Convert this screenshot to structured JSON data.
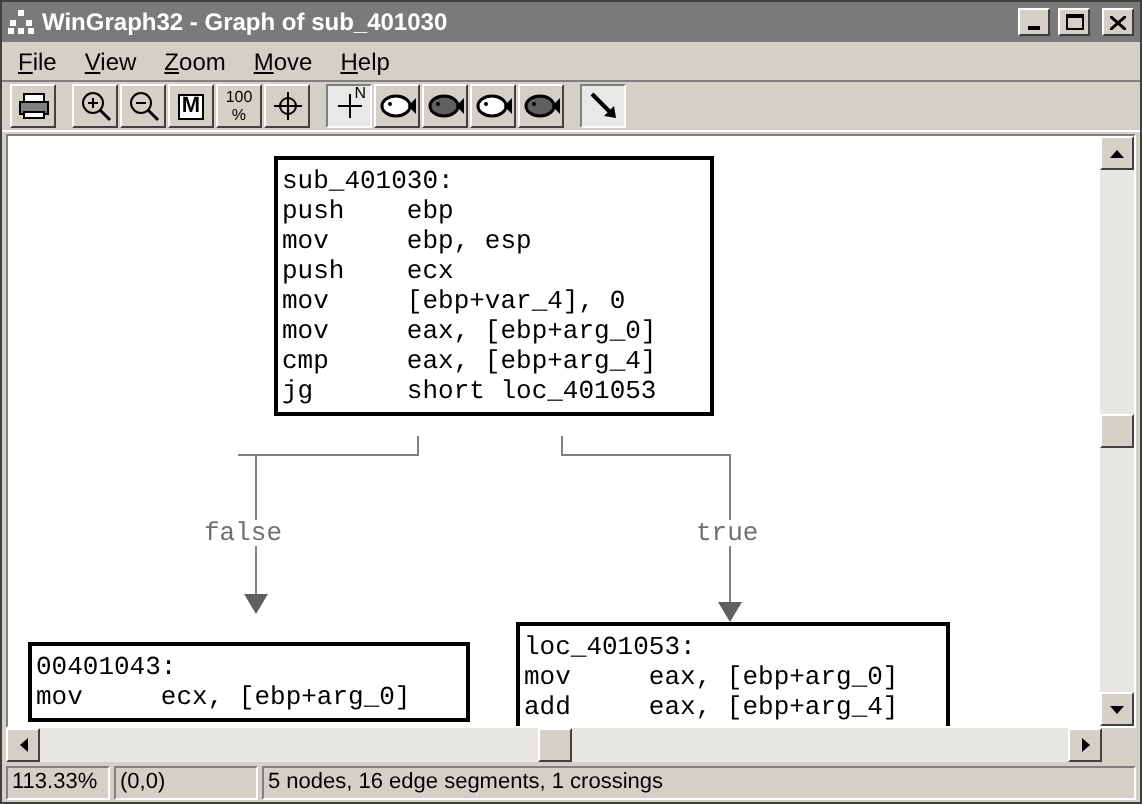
{
  "window": {
    "title": "WinGraph32 - Graph of sub_401030"
  },
  "menu": [
    {
      "label": "File"
    },
    {
      "label": "View"
    },
    {
      "label": "Zoom"
    },
    {
      "label": "Move"
    },
    {
      "label": "Help"
    }
  ],
  "toolbar": [
    {
      "kind": "print",
      "pressed": false
    },
    {
      "kind": "sep"
    },
    {
      "kind": "zoom-in",
      "pressed": false
    },
    {
      "kind": "zoom-out",
      "pressed": false
    },
    {
      "kind": "fit",
      "pressed": false,
      "label": "M"
    },
    {
      "kind": "percent",
      "pressed": false,
      "label": "100",
      "label2": "%"
    },
    {
      "kind": "center",
      "pressed": false
    },
    {
      "kind": "sep"
    },
    {
      "kind": "north",
      "pressed": true,
      "label": "N"
    },
    {
      "kind": "fish",
      "pressed": false,
      "filled": false
    },
    {
      "kind": "fish",
      "pressed": false,
      "filled": true
    },
    {
      "kind": "fish",
      "pressed": false,
      "filled": false
    },
    {
      "kind": "fish",
      "pressed": false,
      "filled": true
    },
    {
      "kind": "sep"
    },
    {
      "kind": "pointer",
      "pressed": true
    }
  ],
  "graph": {
    "nodes": [
      {
        "lines": [
          "sub_401030:",
          "push    ebp",
          "mov     ebp, esp",
          "push    ecx",
          "mov     [ebp+var_4], 0",
          "mov     eax, [ebp+arg_0]",
          "cmp     eax, [ebp+arg_4]",
          "jg      short loc_401053"
        ]
      },
      {
        "lines": [
          "00401043:",
          "mov     ecx, [ebp+arg_0]"
        ]
      },
      {
        "lines": [
          "loc_401053:",
          "mov     eax, [ebp+arg_0]",
          "add     eax, [ebp+arg_4]"
        ]
      }
    ],
    "edges": [
      {
        "label": "false"
      },
      {
        "label": "true"
      }
    ]
  },
  "status_bar": {
    "zoom": "113.33%",
    "position": "(0,0)",
    "info": "5 nodes, 16 edge segments, 1 crossings"
  }
}
